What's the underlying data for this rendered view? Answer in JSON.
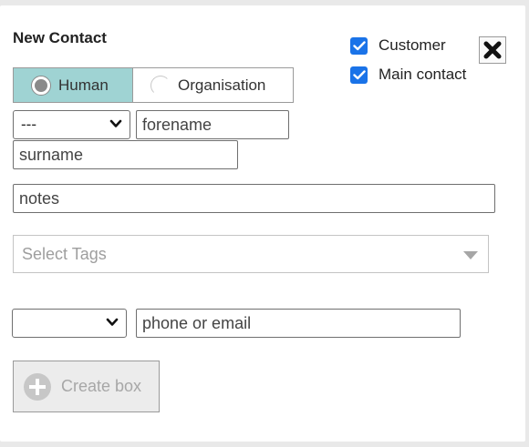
{
  "form": {
    "title": "New Contact"
  },
  "flags": {
    "customer": {
      "label": "Customer",
      "checked": true
    },
    "main_contact": {
      "label": "Main contact",
      "checked": true
    }
  },
  "close": {
    "icon": "close-icon"
  },
  "type_toggle": {
    "human_label": "Human",
    "organisation_label": "Organisation",
    "selected": "Human"
  },
  "name": {
    "salutation_value": "---",
    "forename_placeholder": "forename",
    "surname_placeholder": "surname"
  },
  "notes": {
    "placeholder": "notes"
  },
  "tags": {
    "placeholder": "Select Tags"
  },
  "contact_method": {
    "type_value": "",
    "value_placeholder": "phone or email"
  },
  "create_box": {
    "label": "Create box"
  },
  "colors": {
    "selected_toggle": "#9fd3d3",
    "checkbox": "#1a73e8",
    "background": "#e9e9e9"
  }
}
